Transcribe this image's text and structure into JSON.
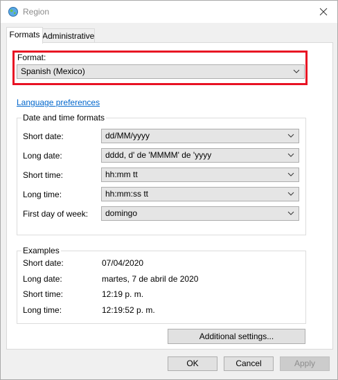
{
  "window": {
    "title": "Region",
    "icon": "globe-icon"
  },
  "tabs": [
    {
      "label": "Formats",
      "active": true
    },
    {
      "label": "Administrative",
      "active": false
    }
  ],
  "format": {
    "label": "Format:",
    "value": "Spanish (Mexico)"
  },
  "language_link": "Language preferences",
  "date_time_formats": {
    "title": "Date and time formats",
    "rows": [
      {
        "label": "Short date:",
        "value": "dd/MM/yyyy"
      },
      {
        "label": "Long date:",
        "value": "dddd, d' de 'MMMM' de 'yyyy"
      },
      {
        "label": "Short time:",
        "value": "hh:mm tt"
      },
      {
        "label": "Long time:",
        "value": "hh:mm:ss tt"
      },
      {
        "label": "First day of week:",
        "value": "domingo"
      }
    ]
  },
  "examples": {
    "title": "Examples",
    "rows": [
      {
        "label": "Short date:",
        "value": "07/04/2020"
      },
      {
        "label": "Long date:",
        "value": "martes, 7 de abril de 2020"
      },
      {
        "label": "Short time:",
        "value": "12:19 p. m."
      },
      {
        "label": "Long time:",
        "value": "12:19:52 p. m."
      }
    ]
  },
  "buttons": {
    "additional": "Additional settings...",
    "ok": "OK",
    "cancel": "Cancel",
    "apply": "Apply"
  },
  "colors": {
    "highlight": "#e81123",
    "link": "#0066cc"
  }
}
